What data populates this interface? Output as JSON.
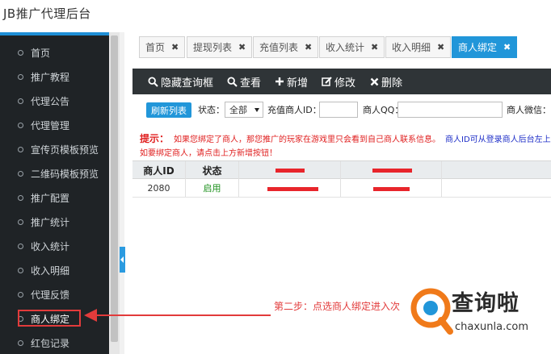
{
  "app": {
    "title": "JB推广代理后台"
  },
  "sidebar": {
    "items": [
      {
        "label": "首页"
      },
      {
        "label": "推广教程"
      },
      {
        "label": "代理公告"
      },
      {
        "label": "代理管理"
      },
      {
        "label": "宣传页模板预览"
      },
      {
        "label": "二维码模板预览"
      },
      {
        "label": "推广配置"
      },
      {
        "label": "推广统计"
      },
      {
        "label": "收入统计"
      },
      {
        "label": "收入明细"
      },
      {
        "label": "代理反馈"
      },
      {
        "label": "商人绑定"
      },
      {
        "label": "红包记录"
      }
    ],
    "active_index": 11
  },
  "tabs": [
    {
      "label": "首页"
    },
    {
      "label": "提现列表"
    },
    {
      "label": "充值列表"
    },
    {
      "label": "收入统计"
    },
    {
      "label": "收入明细"
    },
    {
      "label": "商人绑定"
    }
  ],
  "tab_close_glyph": "✖",
  "toolbar": {
    "hide_query": "隐藏查询框",
    "view": "查看",
    "add": "新增",
    "edit": "修改",
    "delete": "删除"
  },
  "filter": {
    "refresh_label": "刷新列表",
    "status_label": "状态：",
    "status_value": "全部",
    "merchant_id_label": "充值商人ID：",
    "merchant_qq_label": "商人QQ：",
    "merchant_wechat_label": "商人微信："
  },
  "tip": {
    "prefix": "提示：",
    "line1_red": "如果您绑定了商人，那您推广的玩家在游戏里只会看到自己商人联系信息。",
    "line1_blue": "商人ID可从登录商人后台左上角查",
    "line2_red": "如要绑定商人，请点击上方新增按钮！"
  },
  "table": {
    "columns": [
      "商人ID",
      "状态"
    ],
    "rows": [
      {
        "merchant_id": "2080",
        "status": "启用"
      }
    ],
    "status_color": "#1a8f1a"
  },
  "annotation": {
    "text": "第二步：点选商人绑定进入次"
  },
  "watermark": {
    "text": "查询啦",
    "url": "chaxunla.com"
  },
  "colors": {
    "accent": "#2196d9",
    "sidebar_bg": "#1f2326",
    "toolbar_bg": "#2f3437",
    "annotation_red": "#e23b3b"
  },
  "icons": {
    "hide_query": "search-icon",
    "view": "search-icon",
    "add": "plus-icon",
    "edit": "edit-icon",
    "delete": "close-icon"
  }
}
